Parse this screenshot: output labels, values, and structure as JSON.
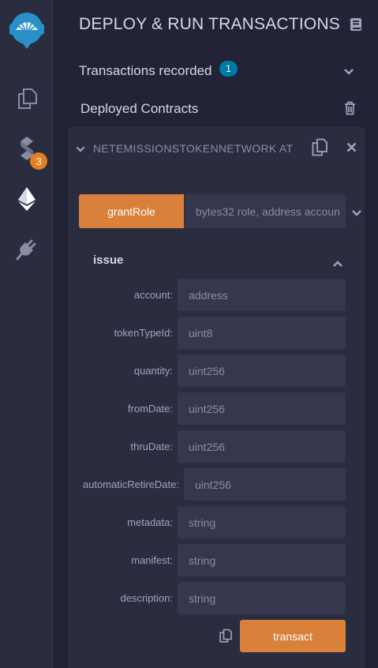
{
  "sidebar": {
    "icons": [
      "remix-logo-icon",
      "file-explorer-icon",
      "solidity-compiler-icon",
      "deploy-run-icon",
      "plugin-manager-icon"
    ],
    "compiler_badge": "3",
    "accent": "#e67e22"
  },
  "header": {
    "title": "DEPLOY & RUN TRANSACTIONS"
  },
  "transactions": {
    "label": "Transactions recorded",
    "count": "1"
  },
  "deployed": {
    "label": "Deployed Contracts",
    "contract_name": "NETEMISSIONSTOKENNETWORK AT"
  },
  "grant_role": {
    "button_label": "grantRole",
    "placeholder": "bytes32 role, address accoun"
  },
  "issue": {
    "title": "issue",
    "fields": [
      {
        "label": "account:",
        "placeholder": "address"
      },
      {
        "label": "tokenTypeId:",
        "placeholder": "uint8"
      },
      {
        "label": "quantity:",
        "placeholder": "uint256"
      },
      {
        "label": "fromDate:",
        "placeholder": "uint256"
      },
      {
        "label": "thruDate:",
        "placeholder": "uint256"
      },
      {
        "label": "automaticRetireDate:",
        "placeholder": "uint256"
      },
      {
        "label": "metadata:",
        "placeholder": "string"
      },
      {
        "label": "manifest:",
        "placeholder": "string"
      },
      {
        "label": "description:",
        "placeholder": "string"
      }
    ],
    "transact_label": "transact"
  },
  "colors": {
    "background": "#222336",
    "panel": "#2a2c3f",
    "input": "#35374d",
    "button": "#d9803b",
    "badge_blue": "#007aa6"
  }
}
